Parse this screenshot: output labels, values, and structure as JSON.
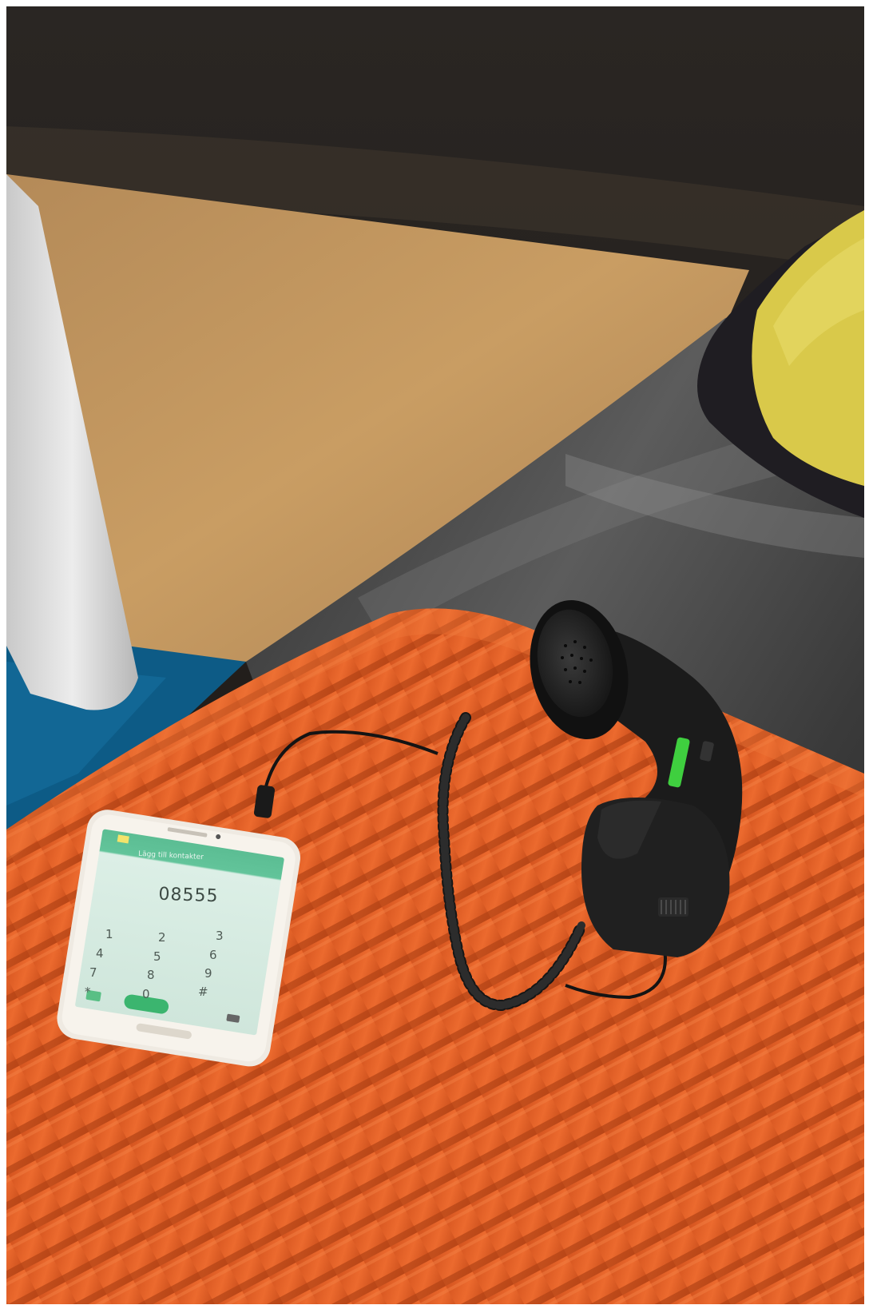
{
  "photo": {
    "colors": {
      "rug_blue": "#0d5b86",
      "floor_tan": "#c89b62",
      "sofa_leather": "#3a3a3a",
      "cushion_orange": "#e7622b",
      "pillow_yellow": "#d9c94a",
      "handset_black": "#1d1d1d",
      "phone_screen_green": "#bfe5d3"
    },
    "phone_screen": {
      "add_contact_text": "Lägg till kontakter",
      "dialed_number": "08555",
      "keys": [
        "1",
        "2",
        "3",
        "4",
        "5",
        "6",
        "7",
        "8",
        "9",
        "*",
        "0",
        "#"
      ]
    }
  }
}
